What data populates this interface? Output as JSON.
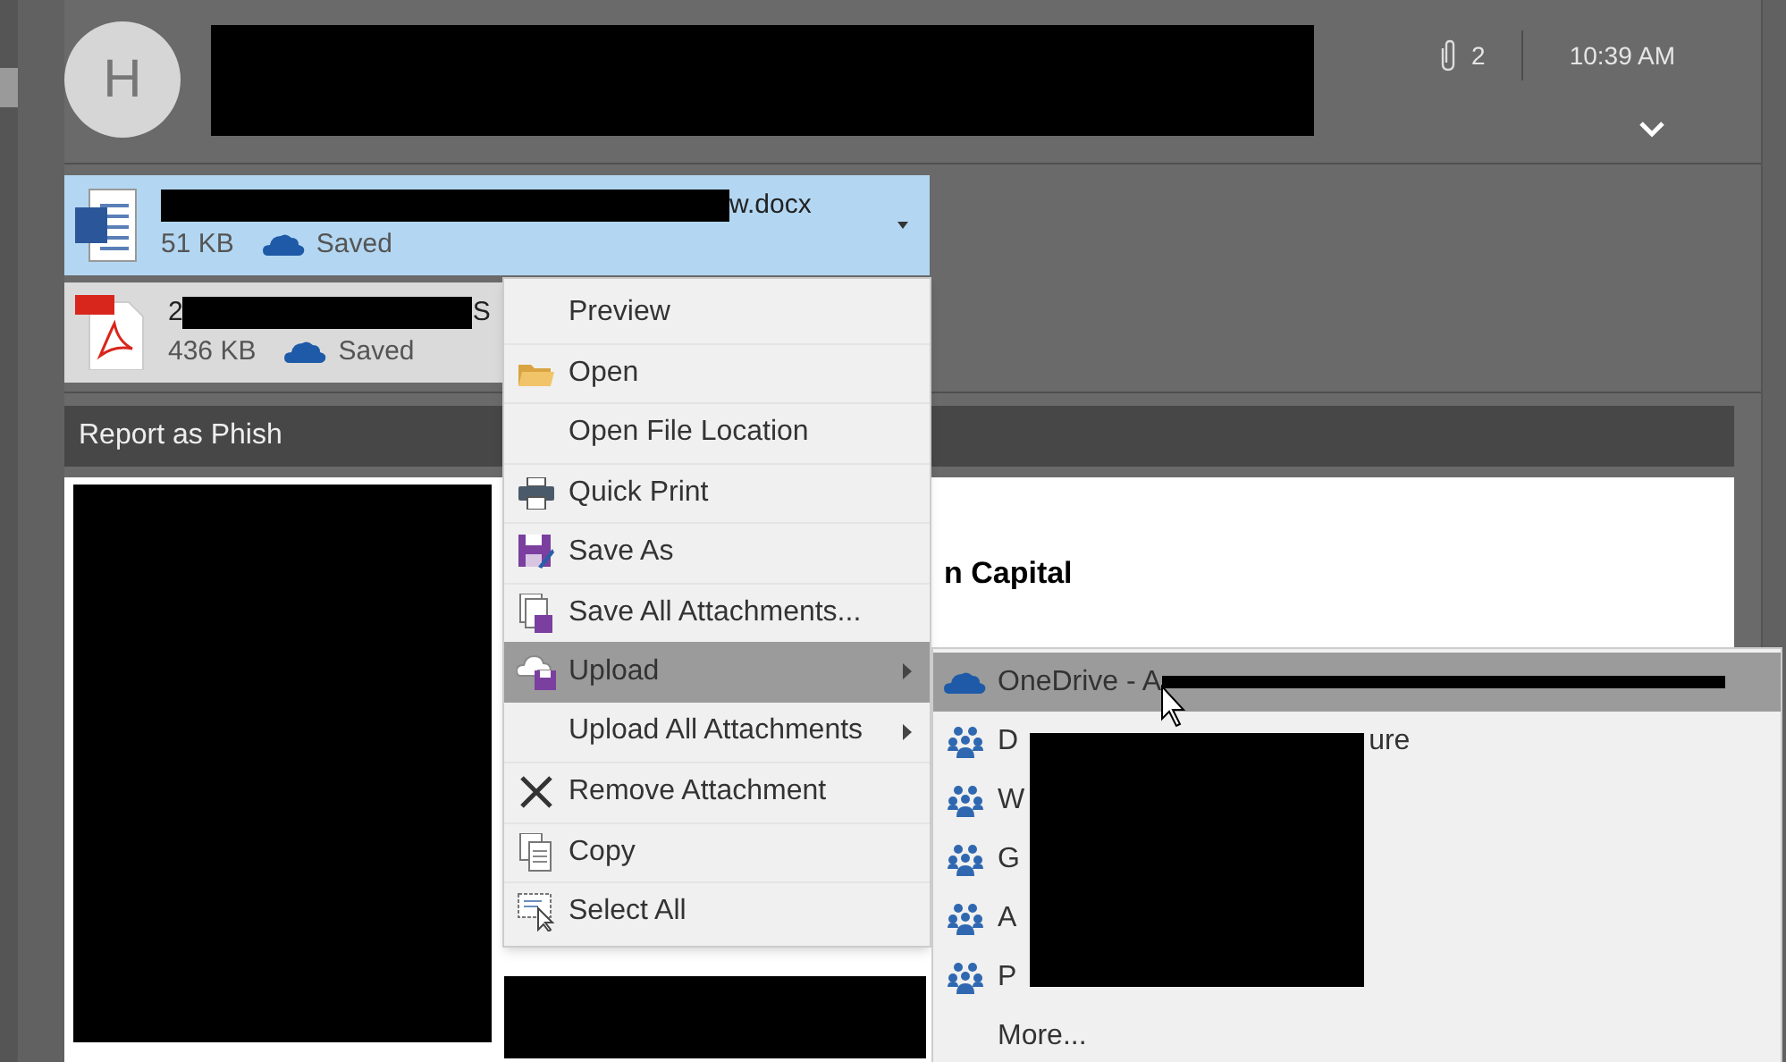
{
  "header": {
    "avatar_initial": "H",
    "attachment_count": "2",
    "time": "10:39 AM"
  },
  "attachments": [
    {
      "name_end": "w.docx",
      "size": "51 KB",
      "status": "Saved",
      "kind": "word",
      "selected": true
    },
    {
      "name_start": "2",
      "name_end": "S",
      "size": "436 KB",
      "status": "Saved",
      "kind": "pdf",
      "selected": false
    }
  ],
  "banner": {
    "label": "Report as Phish"
  },
  "body": {
    "bold_text": "n Capital"
  },
  "context_menu": [
    {
      "label": "Preview",
      "selected": false,
      "submenu": false
    },
    {
      "label": "Open",
      "selected": false,
      "submenu": false
    },
    {
      "label": "Open File Location",
      "selected": false,
      "submenu": false
    },
    {
      "label": "Quick Print",
      "selected": false,
      "submenu": false
    },
    {
      "label": "Save As",
      "selected": false,
      "submenu": false
    },
    {
      "label": "Save All Attachments...",
      "selected": false,
      "submenu": false
    },
    {
      "label": "Upload",
      "selected": true,
      "submenu": true
    },
    {
      "label": "Upload All Attachments",
      "selected": false,
      "submenu": true
    },
    {
      "label": "Remove Attachment",
      "selected": false,
      "submenu": false
    },
    {
      "label": "Copy",
      "selected": false,
      "submenu": false
    },
    {
      "label": "Select All",
      "selected": false,
      "submenu": false
    }
  ],
  "submenu": [
    {
      "kind": "onedrive",
      "label": "OneDrive - A",
      "selected": true
    },
    {
      "kind": "group",
      "label": "D",
      "label_end": "ure",
      "selected": false
    },
    {
      "kind": "group",
      "label": "W",
      "selected": false
    },
    {
      "kind": "group",
      "label": "G",
      "selected": false
    },
    {
      "kind": "group",
      "label": "A",
      "selected": false
    },
    {
      "kind": "group",
      "label": "P",
      "selected": false
    },
    {
      "kind": "more",
      "label": "More...",
      "selected": false
    }
  ]
}
